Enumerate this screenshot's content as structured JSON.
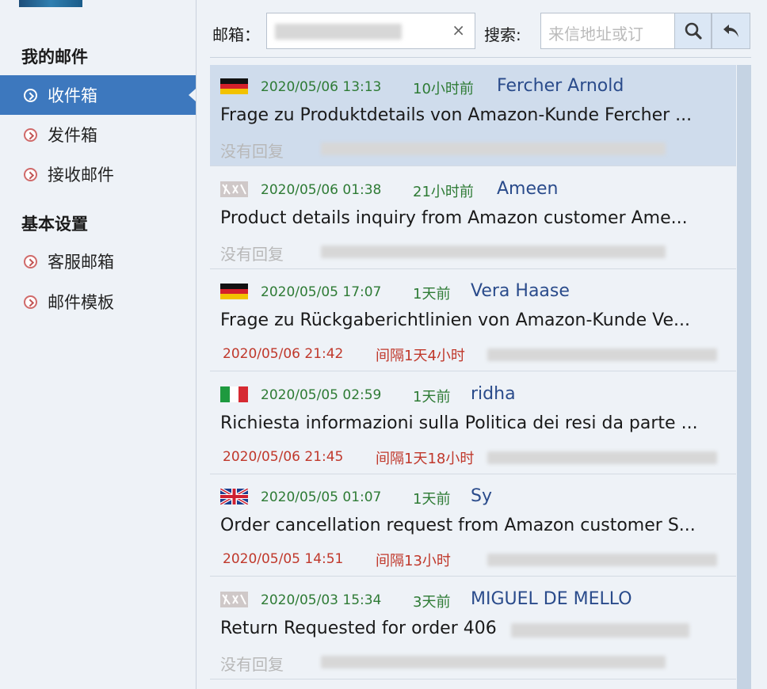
{
  "sidebar": {
    "section_mine": "我的邮件",
    "items": [
      {
        "label": "收件箱",
        "active": true
      },
      {
        "label": "发件箱",
        "active": false
      },
      {
        "label": "接收邮件",
        "active": false
      }
    ],
    "section_settings": "基本设置",
    "settings_items": [
      {
        "label": "客服邮箱"
      },
      {
        "label": "邮件模板"
      }
    ]
  },
  "topbar": {
    "mailbox_label": "邮箱：",
    "clear_symbol": "×",
    "search_label": "搜索:",
    "search_placeholder": "来信地址或订"
  },
  "icons": {
    "search": "magnifier-icon",
    "back": "reply-arrow-icon"
  },
  "colors": {
    "active_nav": "#3d78be",
    "date_green": "#2e7b35",
    "sender_blue": "#2a4b8b",
    "replied_red": "#c0382b",
    "selected_row": "#cfdcec"
  },
  "emails": [
    {
      "flag": "de",
      "date": "2020/05/06 13:13",
      "ago": "10小时前",
      "sender": "Fercher Arnold",
      "subject": "Frage zu Produktdetails von Amazon-Kunde Fercher ...",
      "status": "没有回复",
      "reply_date": "",
      "interval": "",
      "selected": true
    },
    {
      "flag": "unknown",
      "date": "2020/05/06 01:38",
      "ago": "21小时前",
      "sender": "Ameen",
      "subject": "Product details inquiry from Amazon customer Ame...",
      "status": "没有回复",
      "reply_date": "",
      "interval": "",
      "selected": false
    },
    {
      "flag": "de",
      "date": "2020/05/05 17:07",
      "ago": "1天前",
      "sender": "Vera Haase",
      "subject": "Frage zu Rückgaberichtlinien von Amazon-Kunde Ve...",
      "status": "",
      "reply_date": "2020/05/06 21:42",
      "interval": "间隔1天4小时",
      "selected": false
    },
    {
      "flag": "it",
      "date": "2020/05/05 02:59",
      "ago": "1天前",
      "sender": "ridha",
      "subject": "Richiesta informazioni sulla Politica dei resi da parte ...",
      "status": "",
      "reply_date": "2020/05/06 21:45",
      "interval": "间隔1天18小时",
      "selected": false
    },
    {
      "flag": "gb",
      "date": "2020/05/05 01:07",
      "ago": "1天前",
      "sender": "Sy",
      "subject": "Order cancellation request from Amazon customer S...",
      "status": "",
      "reply_date": "2020/05/05 14:51",
      "interval": "间隔13小时",
      "selected": false
    },
    {
      "flag": "unknown",
      "date": "2020/05/03 15:34",
      "ago": "3天前",
      "sender": "MIGUEL DE MELLO",
      "subject": "Return Requested for order 406",
      "status": "没有回复",
      "reply_date": "",
      "interval": "",
      "selected": false
    }
  ]
}
